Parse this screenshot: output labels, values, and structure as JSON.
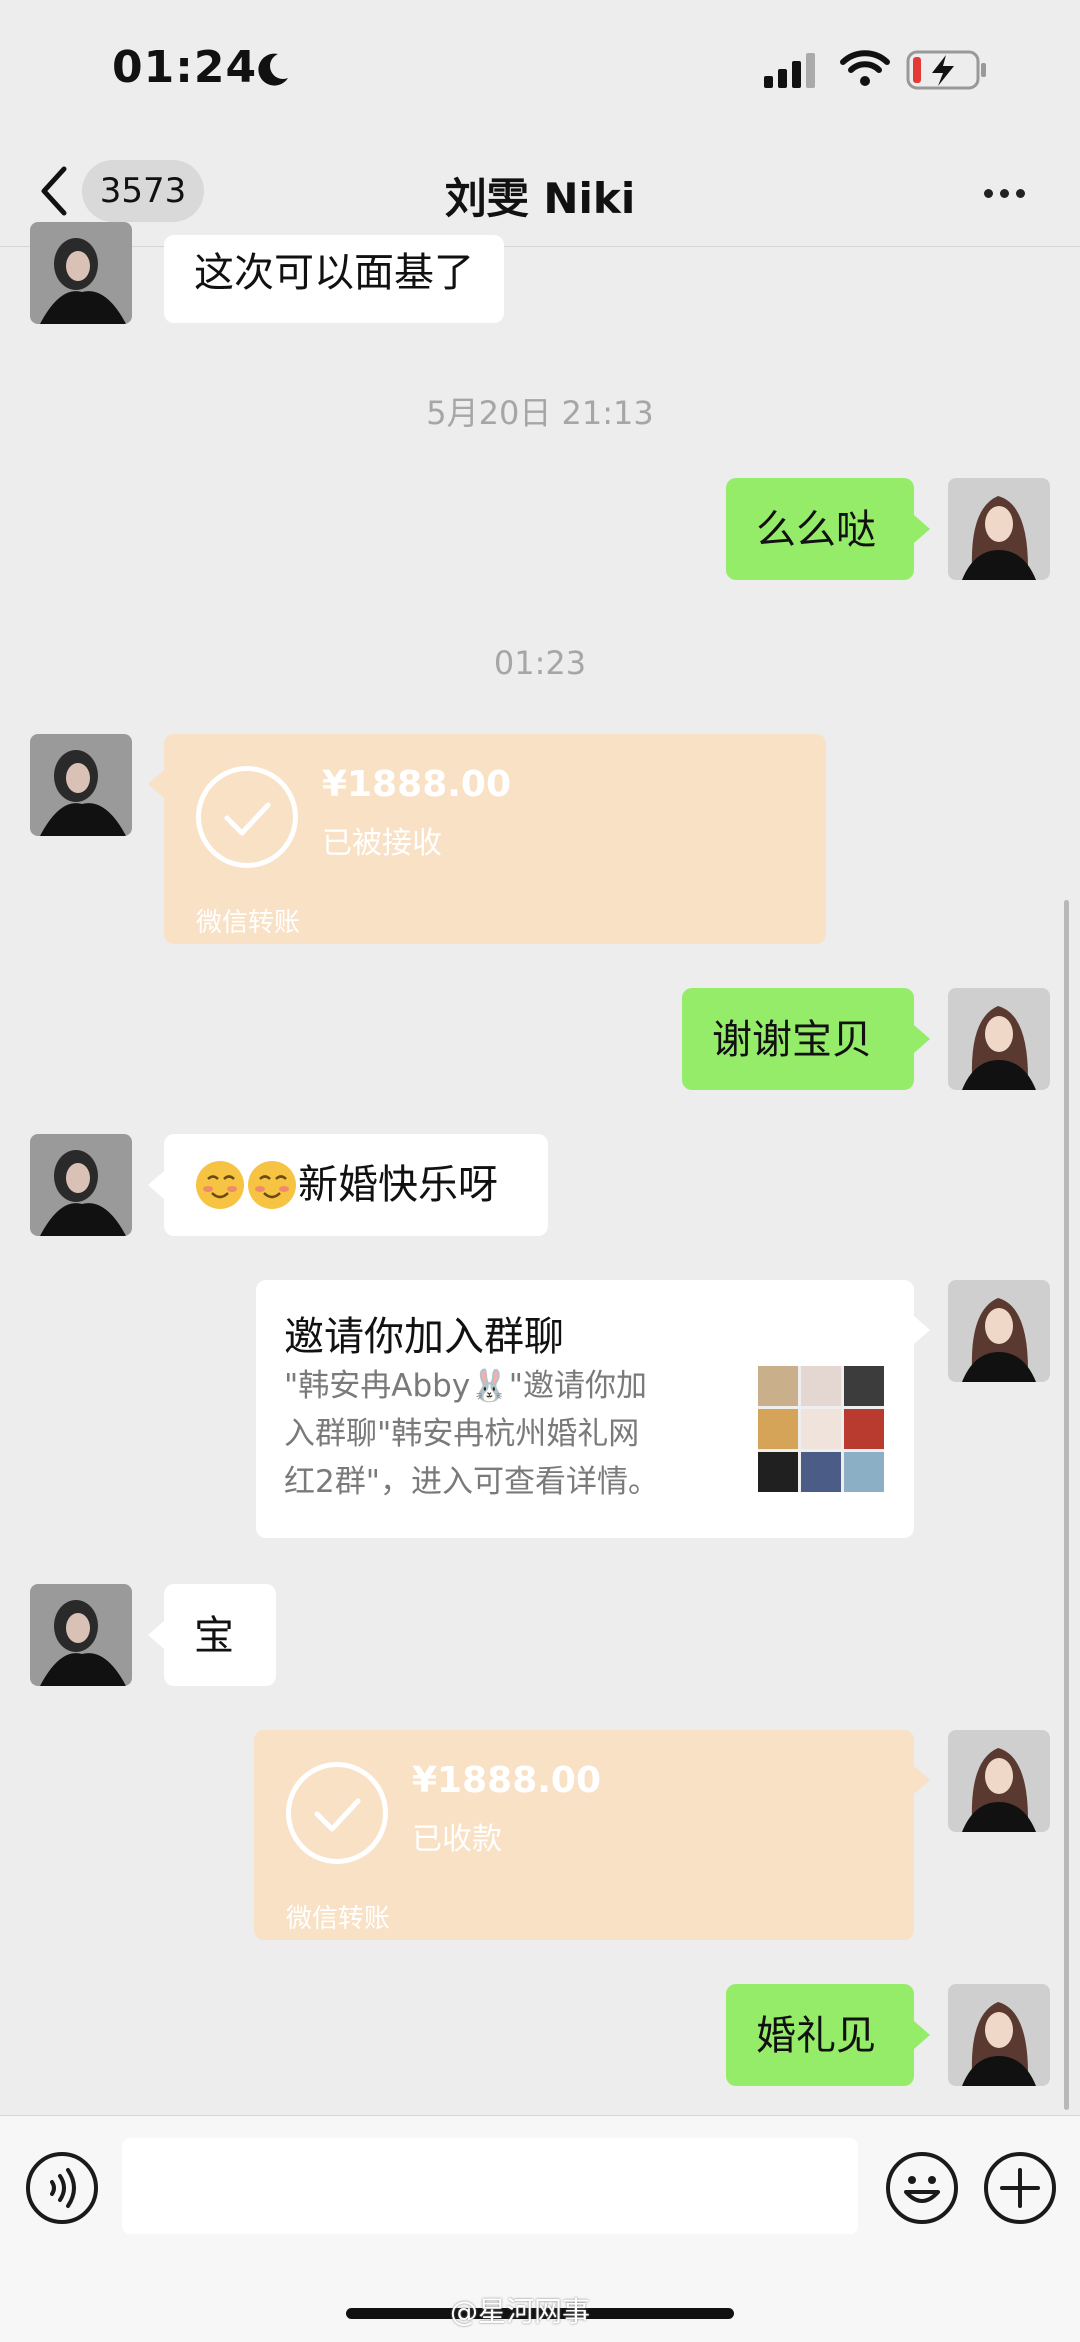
{
  "status_bar": {
    "time": "01:24"
  },
  "nav": {
    "unread_count": "3573",
    "title": "刘雯 Niki"
  },
  "messages": {
    "m1_text": "这次可以面基了",
    "ts1": "5月20日 21:13",
    "m2_text": "么么哒",
    "ts2": "01:23",
    "transfer1": {
      "amount": "¥1888.00",
      "status": "已被接收",
      "footer": "微信转账"
    },
    "m3_text": "谢谢宝贝",
    "m4_text": "新婚快乐呀",
    "invite": {
      "title": "邀请你加入群聊",
      "desc_line1": "\"韩安冉Abby🐰\"邀请你加",
      "desc_line2": "入群聊\"韩安冉杭州婚礼网",
      "desc_line3": "红2群\"，进入可查看详情。"
    },
    "m5_text": "宝",
    "transfer2": {
      "amount": "¥1888.00",
      "status": "已收款",
      "footer": "微信转账"
    },
    "m6_text": "婚礼见"
  },
  "watermark": "@星河网事",
  "colors": {
    "green_bubble": "#95ec69",
    "transfer_bg": "#f9e1c6",
    "chat_bg": "#ededed"
  }
}
